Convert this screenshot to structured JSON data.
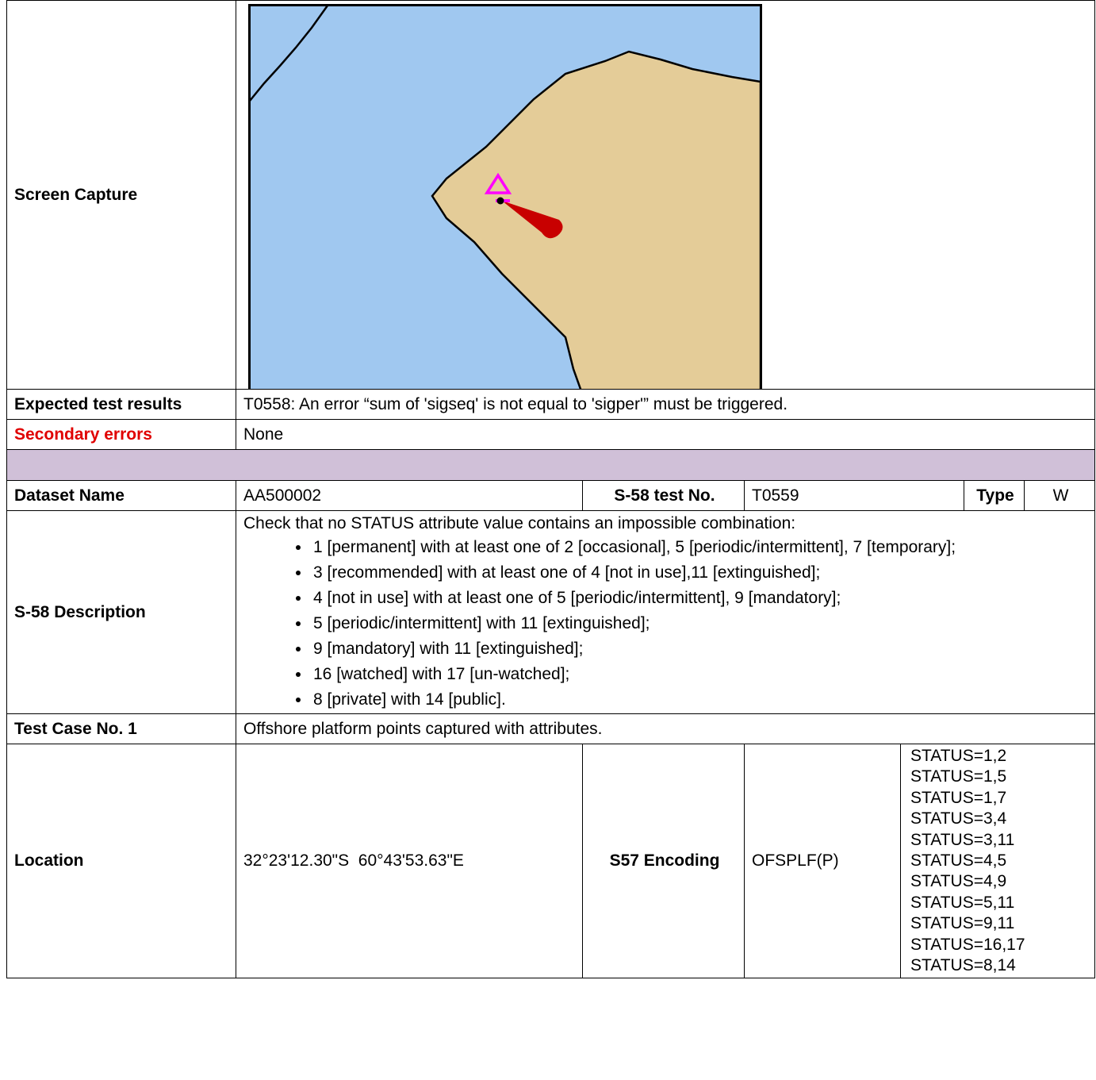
{
  "screen_capture": {
    "label": "Screen Capture"
  },
  "expected_results": {
    "label": "Expected test results",
    "value": "T0558: An error “sum of 'sigseq' is not equal to 'sigper'” must be triggered."
  },
  "secondary_errors": {
    "label": "Secondary errors",
    "value": "None",
    "label_color": "#e00000"
  },
  "dataset": {
    "label": "Dataset Name",
    "value": "AA500002",
    "test_no_label": "S-58 test No.",
    "test_no_value": "T0559",
    "type_label": "Type",
    "type_value": "W"
  },
  "description": {
    "label": "S-58 Description",
    "intro": "Check that no STATUS attribute value contains an impossible combination:",
    "items": [
      "1 [permanent] with at least one of 2 [occasional], 5 [periodic/intermittent], 7 [temporary];",
      "3 [recommended] with at least one of 4 [not in use],11 [extinguished];",
      "4 [not in use] with at least one of 5 [periodic/intermittent], 9 [mandatory];",
      "5 [periodic/intermittent] with 11 [extinguished];",
      "9 [mandatory] with 11 [extinguished];",
      "16 [watched] with 17 [un-watched];",
      "8 [private] with 14 [public]."
    ]
  },
  "test_case": {
    "label": "Test Case No. 1",
    "value": "Offshore platform points captured with attributes."
  },
  "location": {
    "label": "Location",
    "value": "32°23'12.30\"S  60°43'53.63\"E",
    "encoding_label": "S57 Encoding",
    "encoding_value": "OFSPLF(P)",
    "status_values": [
      "STATUS=1,2",
      "STATUS=1,5",
      "STATUS=1,7",
      "STATUS=3,4",
      "STATUS=3,11",
      "STATUS=4,5",
      "STATUS=4,9",
      "STATUS=5,11",
      "STATUS=9,11",
      "STATUS=16,17",
      "STATUS=8,14"
    ]
  },
  "colors": {
    "sea": "#a0c8f0",
    "land": "#e4cc98",
    "symbol_magenta": "#ff00ff",
    "light_flare_red": "#c80000",
    "spacer_row": "#d0c0d8"
  }
}
